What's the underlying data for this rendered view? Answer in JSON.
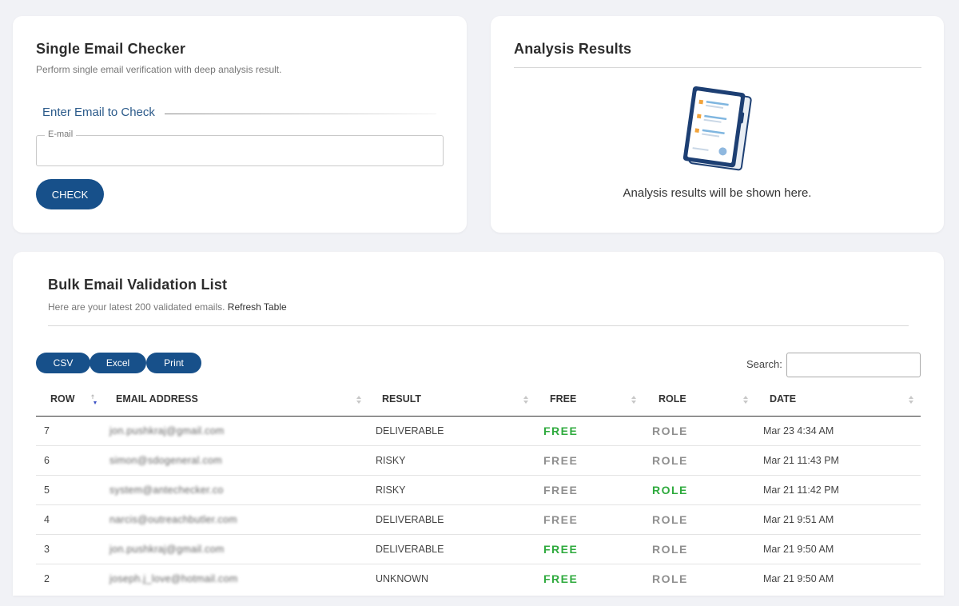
{
  "single": {
    "title": "Single Email Checker",
    "subtitle": "Perform single email verification with deep analysis result.",
    "section_label": "Enter Email to Check",
    "email_legend": "E-mail",
    "email_value": "",
    "check_label": "CHECK"
  },
  "analysis": {
    "title": "Analysis Results",
    "empty_text": "Analysis results will be shown here."
  },
  "bulk": {
    "title": "Bulk Email Validation List",
    "subtitle_prefix": "Here are your latest 200 validated emails.",
    "refresh_link": "Refresh Table",
    "buttons": {
      "csv": "CSV",
      "excel": "Excel",
      "print": "Print"
    },
    "search_label": "Search:",
    "search_value": "",
    "columns": [
      "ROW",
      "EMAIL ADDRESS",
      "RESULT",
      "FREE",
      "ROLE",
      "DATE"
    ],
    "rows": [
      {
        "row": "7",
        "email": "jon.pushkraj@gmail.com",
        "result": "DELIVERABLE",
        "free": "FREE",
        "free_active": true,
        "role": "ROLE",
        "role_active": false,
        "date": "Mar 23 4:34 AM"
      },
      {
        "row": "6",
        "email": "simon@sdogeneral.com",
        "result": "RISKY",
        "free": "FREE",
        "free_active": false,
        "role": "ROLE",
        "role_active": false,
        "date": "Mar 21 11:43 PM"
      },
      {
        "row": "5",
        "email": "system@antechecker.co",
        "result": "RISKY",
        "free": "FREE",
        "free_active": false,
        "role": "ROLE",
        "role_active": true,
        "date": "Mar 21 11:42 PM"
      },
      {
        "row": "4",
        "email": "narcis@outreachbutler.com",
        "result": "DELIVERABLE",
        "free": "FREE",
        "free_active": false,
        "role": "ROLE",
        "role_active": false,
        "date": "Mar 21 9:51 AM"
      },
      {
        "row": "3",
        "email": "jon.pushkraj@gmail.com",
        "result": "DELIVERABLE",
        "free": "FREE",
        "free_active": true,
        "role": "ROLE",
        "role_active": false,
        "date": "Mar 21 9:50 AM"
      },
      {
        "row": "2",
        "email": "joseph.j_love@hotmail.com",
        "result": "UNKNOWN",
        "free": "FREE",
        "free_active": true,
        "role": "ROLE",
        "role_active": false,
        "date": "Mar 21 9:50 AM"
      }
    ]
  },
  "colors": {
    "primary": "#17508a",
    "active_badge": "#2eaa3d",
    "inactive_badge": "#8f8f8f",
    "section_label": "#2b5a8a"
  }
}
